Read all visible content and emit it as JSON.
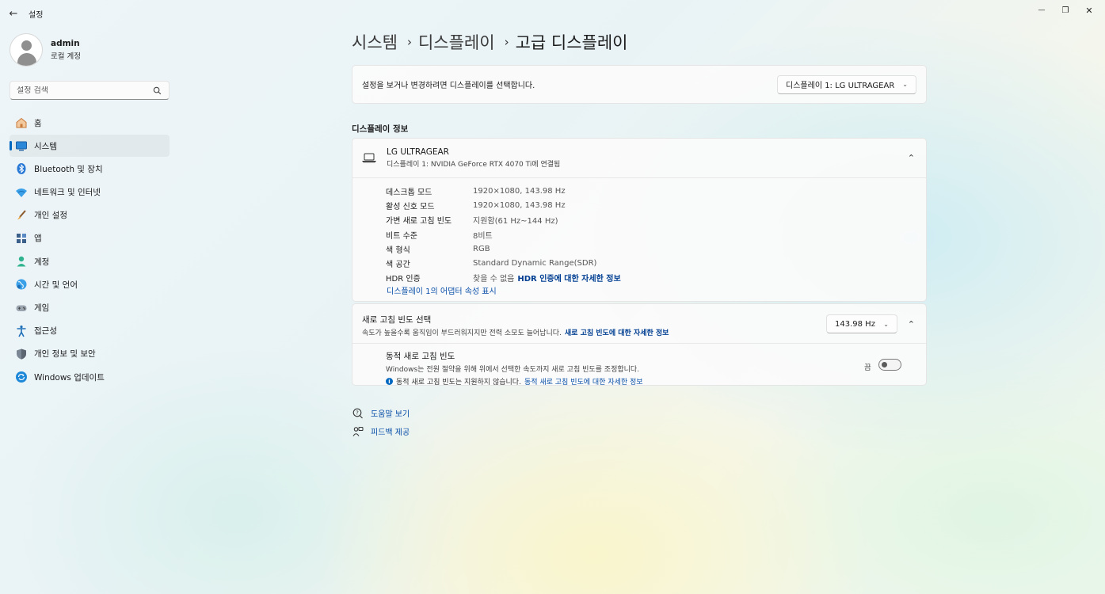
{
  "window": {
    "title": "설정",
    "back_glyph": "←",
    "minimize_glyph": "—",
    "maximize_glyph": "❐",
    "close_glyph": "✕"
  },
  "profile": {
    "name": "admin",
    "account_type": "로컬 계정"
  },
  "search": {
    "placeholder": "설정 검색"
  },
  "sidebar": {
    "items": [
      {
        "label": "홈",
        "icon": "home-icon"
      },
      {
        "label": "시스템",
        "icon": "system-icon",
        "active": true
      },
      {
        "label": "Bluetooth 및 장치",
        "icon": "bluetooth-icon"
      },
      {
        "label": "네트워크 및 인터넷",
        "icon": "network-icon"
      },
      {
        "label": "개인 설정",
        "icon": "brush-icon"
      },
      {
        "label": "앱",
        "icon": "apps-icon"
      },
      {
        "label": "계정",
        "icon": "account-icon"
      },
      {
        "label": "시간 및 언어",
        "icon": "time-language-icon"
      },
      {
        "label": "게임",
        "icon": "gaming-icon"
      },
      {
        "label": "접근성",
        "icon": "accessibility-icon"
      },
      {
        "label": "개인 정보 및 보안",
        "icon": "shield-icon"
      },
      {
        "label": "Windows 업데이트",
        "icon": "windows-update-icon"
      }
    ]
  },
  "breadcrumb": {
    "items": [
      "시스템",
      "디스플레이",
      "고급 디스플레이"
    ],
    "separator": "›"
  },
  "display_select": {
    "label": "설정을 보거나 변경하려면 디스플레이를 선택합니다.",
    "selected": "디스플레이 1: LG ULTRAGEAR"
  },
  "display_info": {
    "section_title": "디스플레이 정보",
    "monitor_name": "LG ULTRAGEAR",
    "monitor_sub": "디스플레이 1: NVIDIA GeForce RTX 4070 Ti에 연결됨",
    "rows": [
      {
        "key": "데스크톱 모드",
        "value": "1920×1080, 143.98 Hz"
      },
      {
        "key": "활성 신호 모드",
        "value": "1920×1080, 143.98 Hz"
      },
      {
        "key": "가변 새로 고침 빈도",
        "value": "지원함(61 Hz~144 Hz)"
      },
      {
        "key": "비트 수준",
        "value": "8비트"
      },
      {
        "key": "색 형식",
        "value": "RGB"
      },
      {
        "key": "색 공간",
        "value": "Standard Dynamic Range(SDR)"
      },
      {
        "key": "HDR 인증",
        "value": "찾을 수 없음",
        "link": "HDR 인증에 대한 자세한 정보"
      }
    ],
    "adapter_link": "디스플레이 1의 어댑터 속성 표시"
  },
  "refresh": {
    "title": "새로 고침 빈도 선택",
    "desc": "속도가 높을수록 움직임이 부드러워지지만 전력 소모도 늘어납니다.",
    "desc_link": "새로 고침 빈도에 대한 자세한 정보",
    "selected_rate": "143.98 Hz",
    "dynamic": {
      "title": "동적 새로 고침 빈도",
      "desc": "Windows는 전원 절약을 위해 위에서 선택한 속도까지 새로 고침 빈도를 조정합니다.",
      "note": "동적 새로 고침 빈도는 지원하지 않습니다.",
      "note_link": "동적 새로 고침 빈도에 대한 자세한 정보",
      "toggle_label": "끔",
      "toggle_on": false
    }
  },
  "help": {
    "help_label": "도움말 보기",
    "feedback_label": "피드백 제공"
  }
}
